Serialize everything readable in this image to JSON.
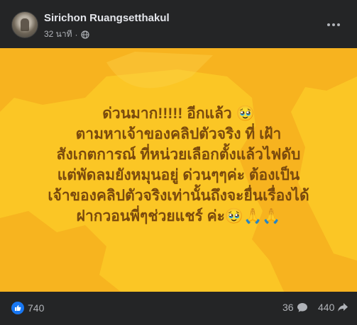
{
  "post": {
    "author": "Sirichon Ruangsetthakul",
    "timestamp": "32 นาที",
    "separator": "·",
    "privacy_icon": "globe-icon",
    "menu_icon": "more-options-icon",
    "background_color": "#fbc625",
    "text_color": "#7a4a0d",
    "lines": [
      "ด่วนมาก!!!!! อีกแล้ว 🥹",
      "ตามหาเจ้าของคลิปตัวจริง ที่ เฝ้า",
      "สังเกตการณ์ ที่หน่วยเลือกตั้งแล้วไฟดับ",
      "แต่พัดลมยังหมุนอยู่ ด่วนๆๆค่ะ ต้องเป็น",
      "เจ้าของคลิปตัวจริงเท่านั้นถึงจะยื่นเรื่องได้",
      "ฝากวอนพี่ๆช่วยแชร์ ค่ะ🥹🙏🙏"
    ]
  },
  "stats": {
    "reactions": "740",
    "comments": "36",
    "shares": "440",
    "reaction_icon": "like-icon",
    "comment_icon": "comment-icon",
    "share_icon": "share-icon"
  },
  "colors": {
    "card_bg": "#242526",
    "accent": "#1877f2"
  }
}
